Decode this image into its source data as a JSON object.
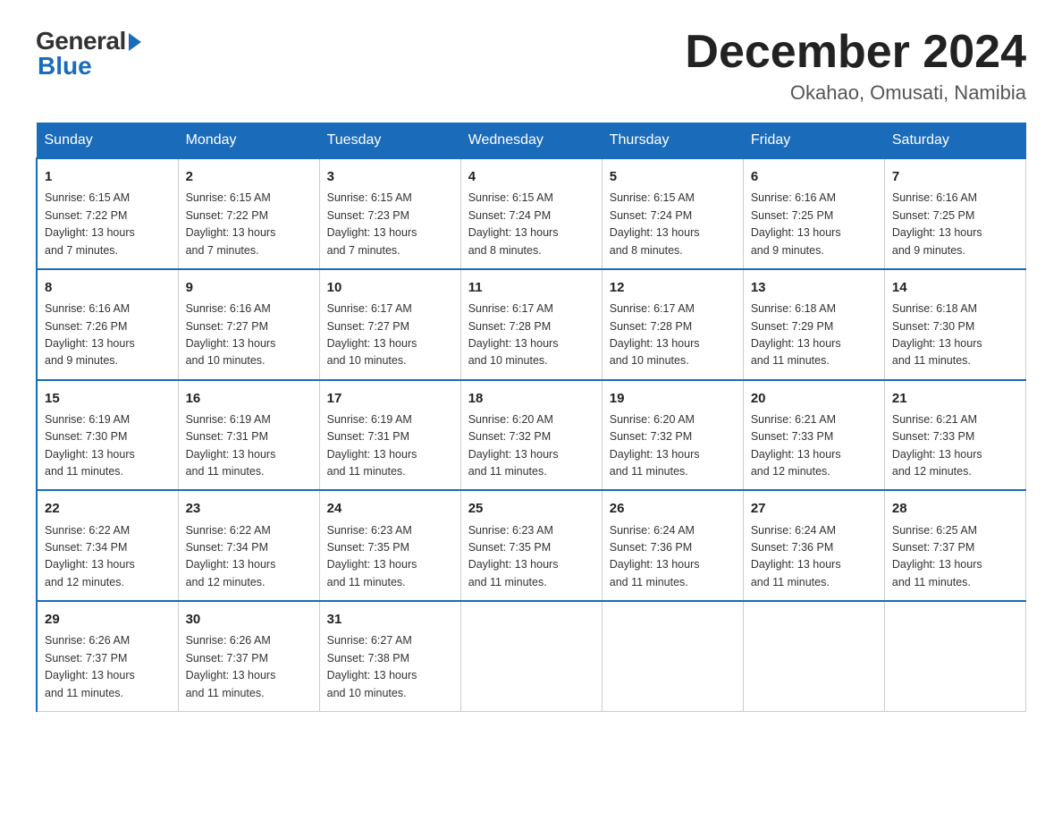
{
  "header": {
    "logo_general": "General",
    "logo_blue": "Blue",
    "month_title": "December 2024",
    "location": "Okahao, Omusati, Namibia"
  },
  "days_of_week": [
    "Sunday",
    "Monday",
    "Tuesday",
    "Wednesday",
    "Thursday",
    "Friday",
    "Saturday"
  ],
  "weeks": [
    [
      {
        "day": "1",
        "sunrise": "6:15 AM",
        "sunset": "7:22 PM",
        "daylight": "13 hours and 7 minutes."
      },
      {
        "day": "2",
        "sunrise": "6:15 AM",
        "sunset": "7:22 PM",
        "daylight": "13 hours and 7 minutes."
      },
      {
        "day": "3",
        "sunrise": "6:15 AM",
        "sunset": "7:23 PM",
        "daylight": "13 hours and 7 minutes."
      },
      {
        "day": "4",
        "sunrise": "6:15 AM",
        "sunset": "7:24 PM",
        "daylight": "13 hours and 8 minutes."
      },
      {
        "day": "5",
        "sunrise": "6:15 AM",
        "sunset": "7:24 PM",
        "daylight": "13 hours and 8 minutes."
      },
      {
        "day": "6",
        "sunrise": "6:16 AM",
        "sunset": "7:25 PM",
        "daylight": "13 hours and 9 minutes."
      },
      {
        "day": "7",
        "sunrise": "6:16 AM",
        "sunset": "7:25 PM",
        "daylight": "13 hours and 9 minutes."
      }
    ],
    [
      {
        "day": "8",
        "sunrise": "6:16 AM",
        "sunset": "7:26 PM",
        "daylight": "13 hours and 9 minutes."
      },
      {
        "day": "9",
        "sunrise": "6:16 AM",
        "sunset": "7:27 PM",
        "daylight": "13 hours and 10 minutes."
      },
      {
        "day": "10",
        "sunrise": "6:17 AM",
        "sunset": "7:27 PM",
        "daylight": "13 hours and 10 minutes."
      },
      {
        "day": "11",
        "sunrise": "6:17 AM",
        "sunset": "7:28 PM",
        "daylight": "13 hours and 10 minutes."
      },
      {
        "day": "12",
        "sunrise": "6:17 AM",
        "sunset": "7:28 PM",
        "daylight": "13 hours and 10 minutes."
      },
      {
        "day": "13",
        "sunrise": "6:18 AM",
        "sunset": "7:29 PM",
        "daylight": "13 hours and 11 minutes."
      },
      {
        "day": "14",
        "sunrise": "6:18 AM",
        "sunset": "7:30 PM",
        "daylight": "13 hours and 11 minutes."
      }
    ],
    [
      {
        "day": "15",
        "sunrise": "6:19 AM",
        "sunset": "7:30 PM",
        "daylight": "13 hours and 11 minutes."
      },
      {
        "day": "16",
        "sunrise": "6:19 AM",
        "sunset": "7:31 PM",
        "daylight": "13 hours and 11 minutes."
      },
      {
        "day": "17",
        "sunrise": "6:19 AM",
        "sunset": "7:31 PM",
        "daylight": "13 hours and 11 minutes."
      },
      {
        "day": "18",
        "sunrise": "6:20 AM",
        "sunset": "7:32 PM",
        "daylight": "13 hours and 11 minutes."
      },
      {
        "day": "19",
        "sunrise": "6:20 AM",
        "sunset": "7:32 PM",
        "daylight": "13 hours and 11 minutes."
      },
      {
        "day": "20",
        "sunrise": "6:21 AM",
        "sunset": "7:33 PM",
        "daylight": "13 hours and 12 minutes."
      },
      {
        "day": "21",
        "sunrise": "6:21 AM",
        "sunset": "7:33 PM",
        "daylight": "13 hours and 12 minutes."
      }
    ],
    [
      {
        "day": "22",
        "sunrise": "6:22 AM",
        "sunset": "7:34 PM",
        "daylight": "13 hours and 12 minutes."
      },
      {
        "day": "23",
        "sunrise": "6:22 AM",
        "sunset": "7:34 PM",
        "daylight": "13 hours and 12 minutes."
      },
      {
        "day": "24",
        "sunrise": "6:23 AM",
        "sunset": "7:35 PM",
        "daylight": "13 hours and 11 minutes."
      },
      {
        "day": "25",
        "sunrise": "6:23 AM",
        "sunset": "7:35 PM",
        "daylight": "13 hours and 11 minutes."
      },
      {
        "day": "26",
        "sunrise": "6:24 AM",
        "sunset": "7:36 PM",
        "daylight": "13 hours and 11 minutes."
      },
      {
        "day": "27",
        "sunrise": "6:24 AM",
        "sunset": "7:36 PM",
        "daylight": "13 hours and 11 minutes."
      },
      {
        "day": "28",
        "sunrise": "6:25 AM",
        "sunset": "7:37 PM",
        "daylight": "13 hours and 11 minutes."
      }
    ],
    [
      {
        "day": "29",
        "sunrise": "6:26 AM",
        "sunset": "7:37 PM",
        "daylight": "13 hours and 11 minutes."
      },
      {
        "day": "30",
        "sunrise": "6:26 AM",
        "sunset": "7:37 PM",
        "daylight": "13 hours and 11 minutes."
      },
      {
        "day": "31",
        "sunrise": "6:27 AM",
        "sunset": "7:38 PM",
        "daylight": "13 hours and 10 minutes."
      },
      null,
      null,
      null,
      null
    ]
  ],
  "labels": {
    "sunrise": "Sunrise:",
    "sunset": "Sunset:",
    "daylight": "Daylight:"
  }
}
